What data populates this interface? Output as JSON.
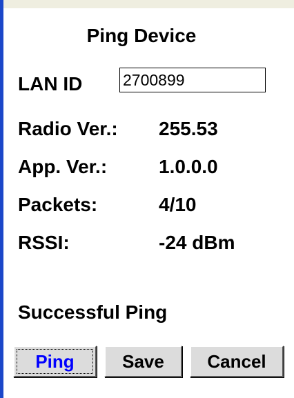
{
  "dialog": {
    "title": "Ping Device",
    "lan_id": {
      "label": "LAN ID",
      "value": "2700899"
    },
    "fields": [
      {
        "label": "Radio Ver.:",
        "value": "255.53"
      },
      {
        "label": "App. Ver.:",
        "value": "1.0.0.0"
      },
      {
        "label": "Packets:",
        "value": "4/10"
      },
      {
        "label": "RSSI:",
        "value": "-24 dBm"
      }
    ],
    "status": "Successful Ping",
    "buttons": {
      "ping": "Ping",
      "save": "Save",
      "cancel": "Cancel"
    }
  },
  "colors": {
    "window_edge": "#1b47c9",
    "top_strip": "#efeee0",
    "button_face": "#dcdcdc",
    "ping_label": "#0000ff"
  }
}
